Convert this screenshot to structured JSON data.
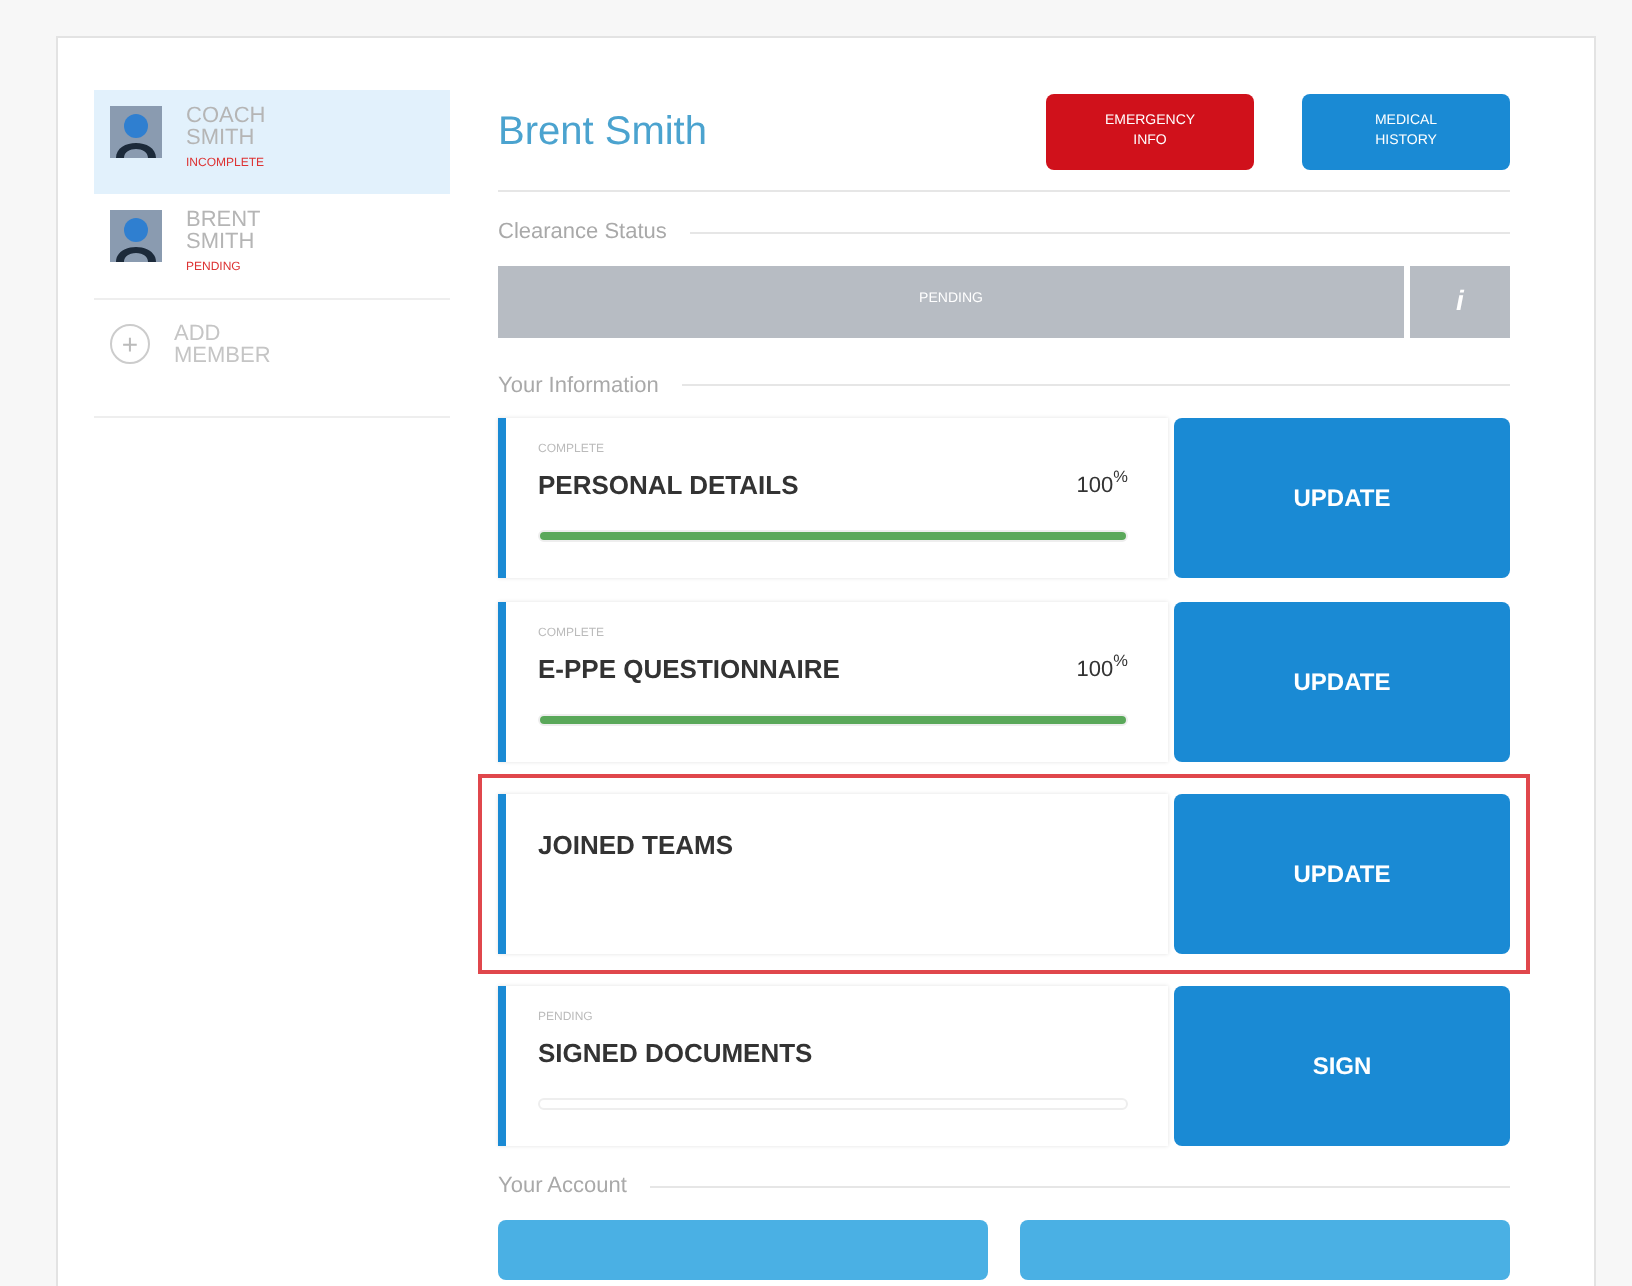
{
  "sidebar": {
    "members": [
      {
        "name": "COACH SMITH",
        "status": "INCOMPLETE",
        "selected": true
      },
      {
        "name": "BRENT SMITH",
        "status": "PENDING",
        "selected": false
      }
    ],
    "add_member": {
      "icon": "+",
      "label": "ADD MEMBER"
    }
  },
  "header": {
    "title": "Brent Smith",
    "buttons": [
      {
        "label": "EMERGENCY INFO",
        "kind": "danger"
      },
      {
        "label": "MEDICAL HISTORY",
        "kind": "primary"
      }
    ]
  },
  "clearance": {
    "heading": "Clearance Status",
    "status": "PENDING",
    "info": "i"
  },
  "information": {
    "heading": "Your Information",
    "items": [
      {
        "kind": "progress",
        "status": "COMPLETE",
        "title": "PERSONAL DETAILS",
        "percent": "100$^{%}$",
        "level": 1,
        "action": "UPDATE",
        "highlighted": false
      },
      {
        "kind": "progress",
        "status": "COMPLETE",
        "title": "E-PPE QUESTIONNAIRE",
        "percent": "100$^{%}$",
        "level": 1,
        "action": "UPDATE",
        "highlighted": false
      },
      {
        "kind": "plain",
        "title": "JOINED TEAMS",
        "action": "UPDATE",
        "highlighted": true
      },
      {
        "kind": "progress",
        "status": "PENDING",
        "title": "SIGNED DOCUMENTS",
        "action": "SIGN",
        "highlighted": false
      }
    ]
  },
  "account": {
    "heading": "Your Account"
  }
}
